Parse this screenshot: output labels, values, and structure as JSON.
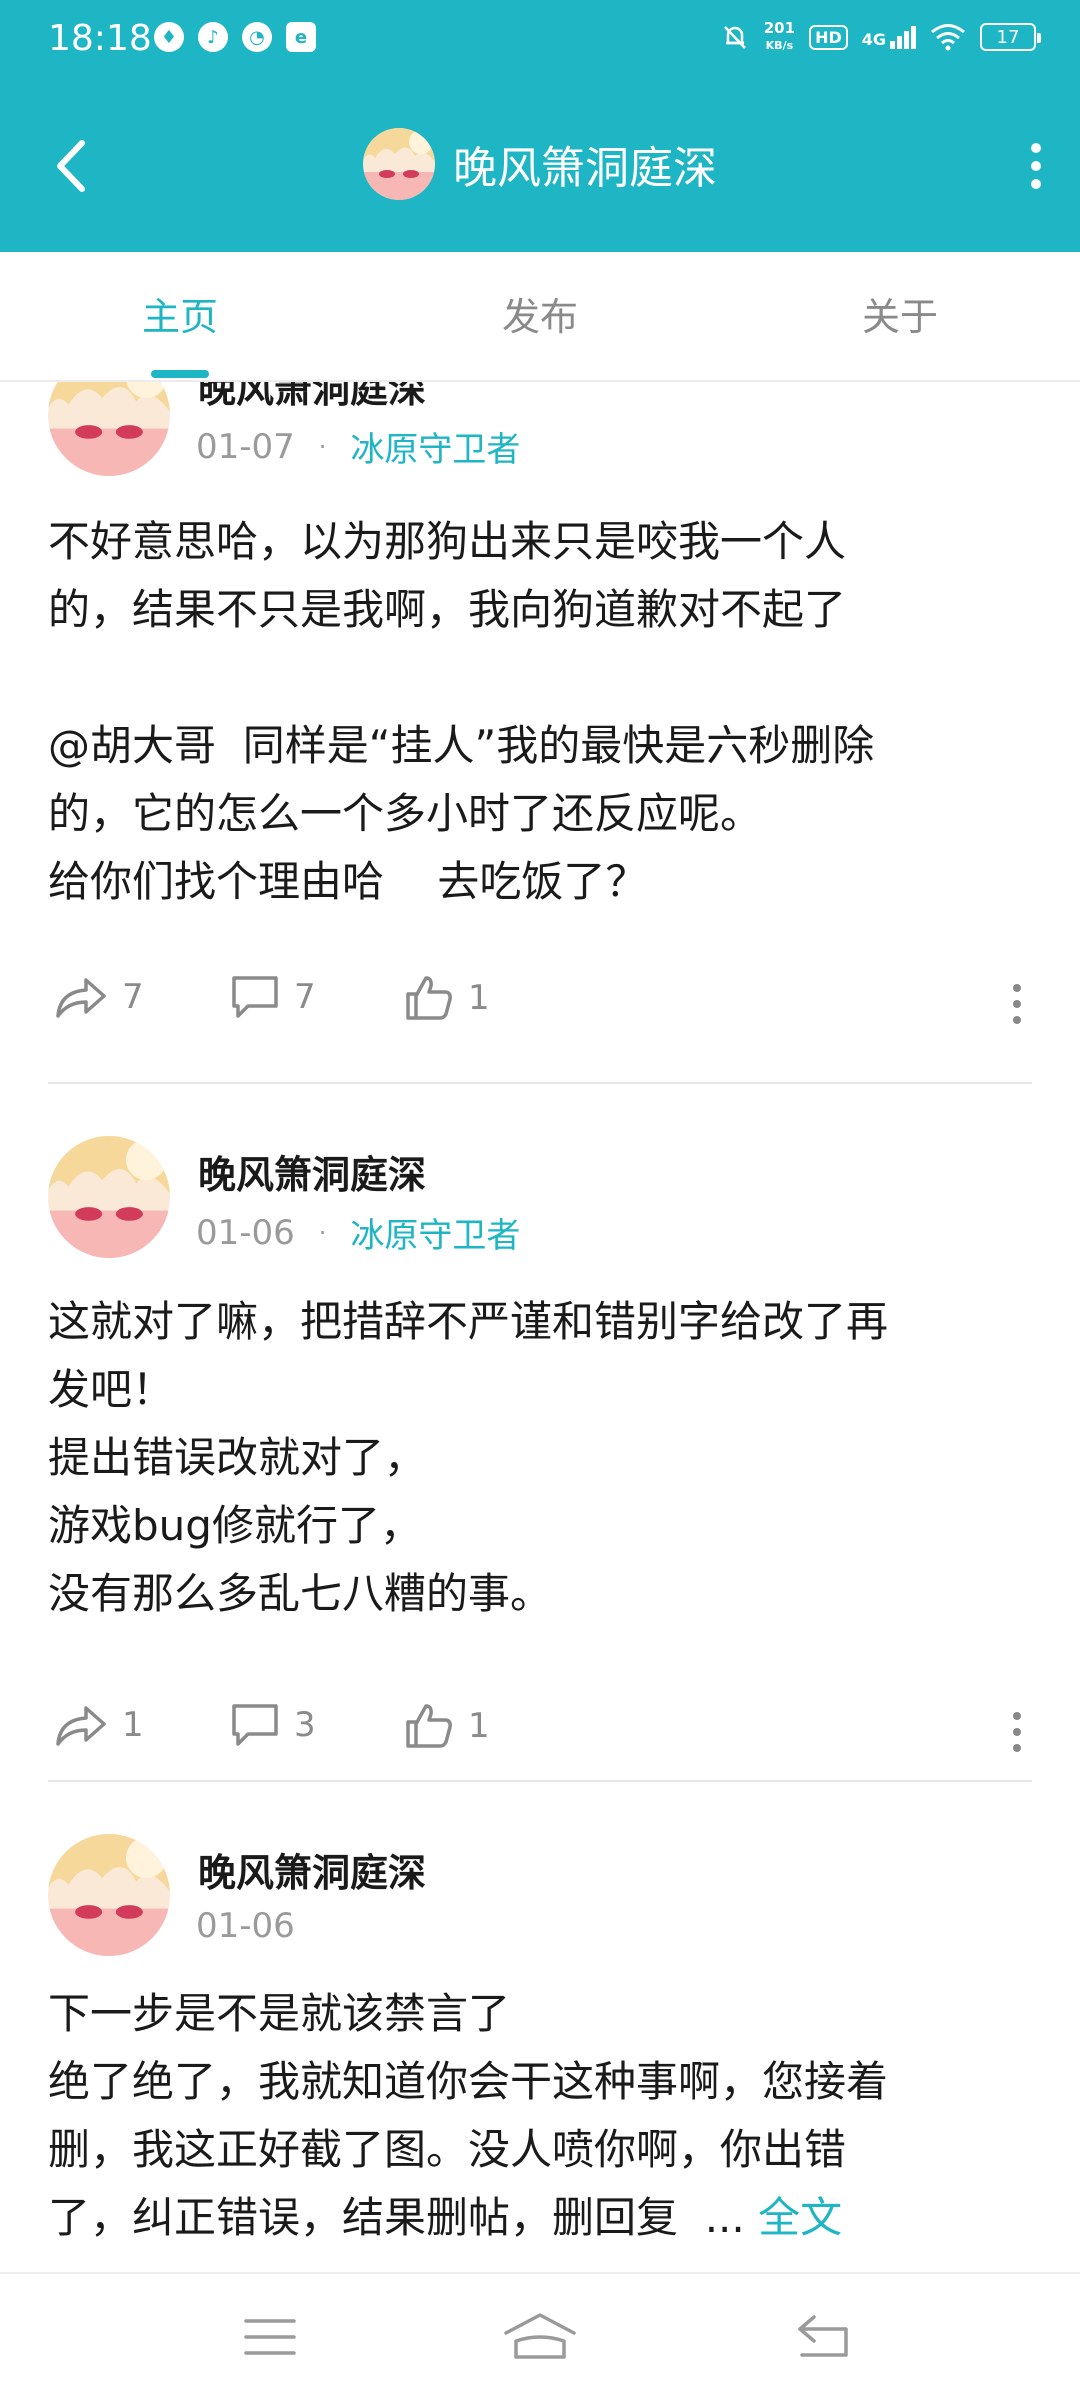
{
  "status_bar": {
    "time": "18:18",
    "net_speed_value": "201",
    "net_speed_unit": "KB/s",
    "hd_badge": "HD",
    "network": "4G",
    "battery": "17"
  },
  "header": {
    "title": "晚风箫洞庭深",
    "back_icon": "chevron-left-icon",
    "more_icon": "vertical-dots-icon"
  },
  "tabs": [
    {
      "label": "主页",
      "active": true
    },
    {
      "label": "发布",
      "active": false
    },
    {
      "label": "关于",
      "active": false
    }
  ],
  "posts": [
    {
      "author": "晚风箫洞庭深",
      "date": "01-07",
      "tag": "冰原守卫者",
      "body_lines": [
        "不好意思哈，以为那狗出来只是咬我一个人",
        "的，结果不只是我啊，我向狗道歉对不起了",
        "",
        "@胡大哥  同样是“挂人”我的最快是六秒删除",
        "的，它的怎么一个多小时了还反应呢。",
        "给你们找个理由哈    去吃饭了？"
      ],
      "shares": "7",
      "comments": "7",
      "likes": "1"
    },
    {
      "author": "晚风箫洞庭深",
      "date": "01-06",
      "tag": "冰原守卫者",
      "body_lines": [
        "这就对了嘛，把措辞不严谨和错别字给改了再",
        "发吧！",
        "提出错误改就对了，",
        "游戏bug修就行了，",
        "没有那么多乱七八糟的事。"
      ],
      "shares": "1",
      "comments": "3",
      "likes": "1"
    },
    {
      "author": "晚风箫洞庭深",
      "date": "01-06",
      "body_lines": [
        "下一步是不是就该禁言了",
        "绝了绝了，我就知道你会干这种事啊，您接着",
        "删，我这正好截了图。没人喷你啊，你出错",
        "了，纠正错误，结果删帖，删回复  ... "
      ],
      "full_text_link": "全文"
    }
  ],
  "colors": {
    "accent": "#1eb5c4",
    "muted": "#9a9a9a",
    "text": "#1a1a1a"
  }
}
